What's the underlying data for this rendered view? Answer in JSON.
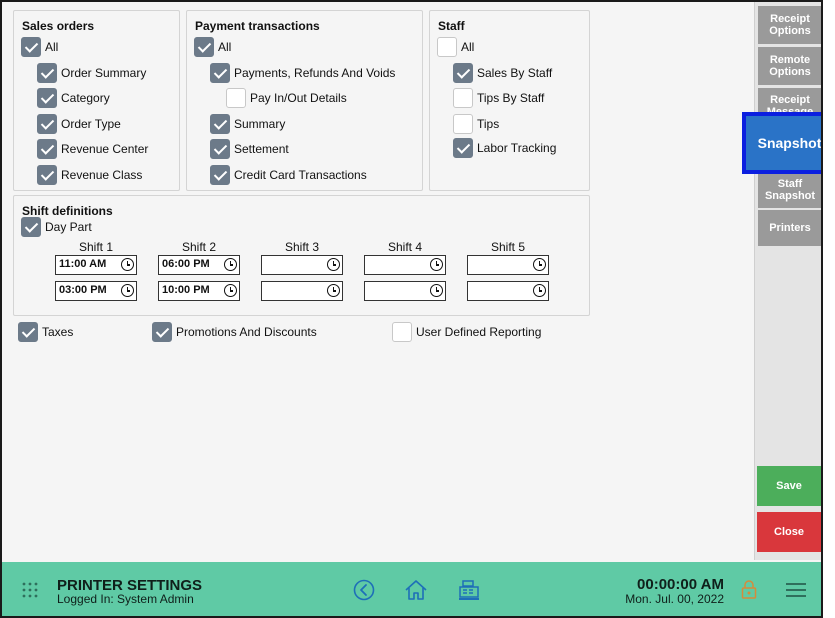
{
  "sales_orders": {
    "title": "Sales orders",
    "items": [
      {
        "label": "All",
        "checked": true
      },
      {
        "label": "Order Summary",
        "checked": true
      },
      {
        "label": "Category",
        "checked": true
      },
      {
        "label": "Order Type",
        "checked": true
      },
      {
        "label": "Revenue Center",
        "checked": true
      },
      {
        "label": "Revenue Class",
        "checked": true
      }
    ]
  },
  "payment_transactions": {
    "title": "Payment transactions",
    "items": [
      {
        "label": "All",
        "checked": true
      },
      {
        "label": "Payments, Refunds And Voids",
        "checked": true
      },
      {
        "label": "Pay In/Out Details",
        "checked": false
      },
      {
        "label": "Summary",
        "checked": true
      },
      {
        "label": "Settement",
        "checked": true
      },
      {
        "label": "Credit Card Transactions",
        "checked": true
      }
    ]
  },
  "staff": {
    "title": "Staff",
    "items": [
      {
        "label": "All",
        "checked": false
      },
      {
        "label": "Sales By Staff",
        "checked": true
      },
      {
        "label": "Tips By Staff",
        "checked": false
      },
      {
        "label": "Tips",
        "checked": false
      },
      {
        "label": "Labor Tracking",
        "checked": true
      }
    ]
  },
  "shift_definitions": {
    "title": "Shift definitions",
    "day_part": {
      "label": "Day Part",
      "checked": true
    },
    "shifts": [
      {
        "name": "Shift 1",
        "start": "11:00 AM",
        "end": "03:00 PM"
      },
      {
        "name": "Shift 2",
        "start": "06:00 PM",
        "end": "10:00 PM"
      },
      {
        "name": "Shift 3",
        "start": "",
        "end": ""
      },
      {
        "name": "Shift 4",
        "start": "",
        "end": ""
      },
      {
        "name": "Shift 5",
        "start": "",
        "end": ""
      }
    ]
  },
  "extras": [
    {
      "label": "Taxes",
      "checked": true
    },
    {
      "label": "Promotions And Discounts",
      "checked": true
    },
    {
      "label": "User Defined Reporting",
      "checked": false
    }
  ],
  "sidebar": {
    "receipt_options": "Receipt Options",
    "remote_options": "Remote Options",
    "receipt_message": "Receipt Message",
    "snapshot": "Snapshot",
    "staff_snapshot": "Staff Snapshot",
    "printers": "Printers",
    "save": "Save",
    "close": "Close"
  },
  "footer": {
    "title": "PRINTER SETTINGS",
    "logged_in": "Logged In:  System Admin",
    "time": "00:00:00 AM",
    "date": "Mon. Jul. 00, 2022"
  },
  "colors": {
    "footer_bg": "#5fcaa5",
    "accent_blue": "#2a73c7",
    "save_green": "#4cae5b",
    "close_red": "#d9373c",
    "checkbox_on": "#6c7a89"
  }
}
